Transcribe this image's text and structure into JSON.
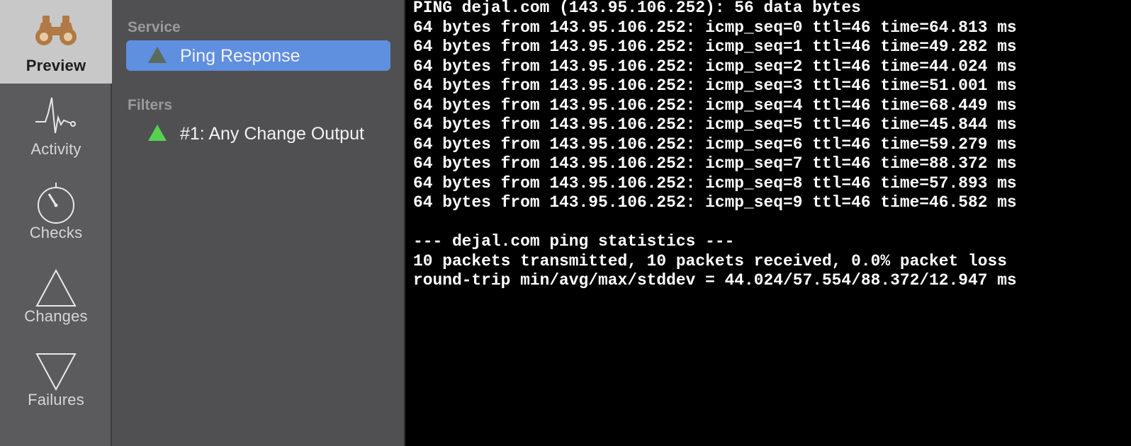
{
  "sidebar": {
    "items": [
      {
        "label": "Preview",
        "icon": "binoculars-icon",
        "selected": true
      },
      {
        "label": "Activity",
        "icon": "activity-pulse-icon",
        "selected": false
      },
      {
        "label": "Checks",
        "icon": "stopwatch-icon",
        "selected": false
      },
      {
        "label": "Changes",
        "icon": "triangle-up-icon",
        "selected": false
      },
      {
        "label": "Failures",
        "icon": "triangle-down-icon",
        "selected": false
      }
    ]
  },
  "sourcelist": {
    "service_header": "Service",
    "service_item": {
      "label": "Ping Response",
      "status_color": "#5a6b5c"
    },
    "filters_header": "Filters",
    "filter_item": {
      "label": "#1: Any Change Output",
      "status_color": "#55d34f"
    }
  },
  "colors": {
    "selection": "#5f8fdf",
    "rail_selected": "#c8c8c8",
    "binoculars": "#b07a46"
  },
  "output": {
    "lines": [
      "PING dejal.com (143.95.106.252): 56 data bytes",
      "64 bytes from 143.95.106.252: icmp_seq=0 ttl=46 time=64.813 ms",
      "64 bytes from 143.95.106.252: icmp_seq=1 ttl=46 time=49.282 ms",
      "64 bytes from 143.95.106.252: icmp_seq=2 ttl=46 time=44.024 ms",
      "64 bytes from 143.95.106.252: icmp_seq=3 ttl=46 time=51.001 ms",
      "64 bytes from 143.95.106.252: icmp_seq=4 ttl=46 time=68.449 ms",
      "64 bytes from 143.95.106.252: icmp_seq=5 ttl=46 time=45.844 ms",
      "64 bytes from 143.95.106.252: icmp_seq=6 ttl=46 time=59.279 ms",
      "64 bytes from 143.95.106.252: icmp_seq=7 ttl=46 time=88.372 ms",
      "64 bytes from 143.95.106.252: icmp_seq=8 ttl=46 time=57.893 ms",
      "64 bytes from 143.95.106.252: icmp_seq=9 ttl=46 time=46.582 ms",
      "",
      "--- dejal.com ping statistics ---",
      "10 packets transmitted, 10 packets received, 0.0% packet loss",
      "round-trip min/avg/max/stddev = 44.024/57.554/88.372/12.947 ms"
    ]
  }
}
